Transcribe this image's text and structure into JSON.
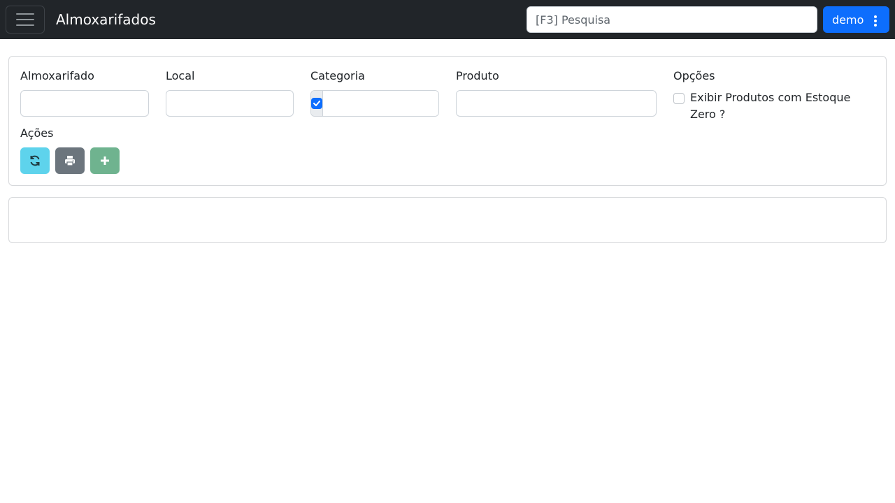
{
  "header": {
    "title": "Almoxarifados",
    "search_placeholder": "[F3] Pesquisa",
    "user_label": "demo"
  },
  "filters": {
    "almoxarifado_label": "Almoxarifado",
    "almoxarifado_value": "",
    "local_label": "Local",
    "local_value": "",
    "categoria_label": "Categoria",
    "categoria_checked": true,
    "categoria_value": "",
    "produto_label": "Produto",
    "produto_value": "",
    "opcoes_label": "Opções",
    "zero_stock_label": "Exibir Produtos com Estoque Zero ?",
    "zero_stock_checked": false,
    "acoes_label": "Ações"
  },
  "actions": [
    {
      "name": "refresh-icon",
      "color": "#5ed3ec"
    },
    {
      "name": "print-icon",
      "color": "#6c757d"
    },
    {
      "name": "plus-icon",
      "color": "#6fb38f"
    }
  ],
  "colors": {
    "navbar": "#212529",
    "primary": "#0d6efd"
  }
}
